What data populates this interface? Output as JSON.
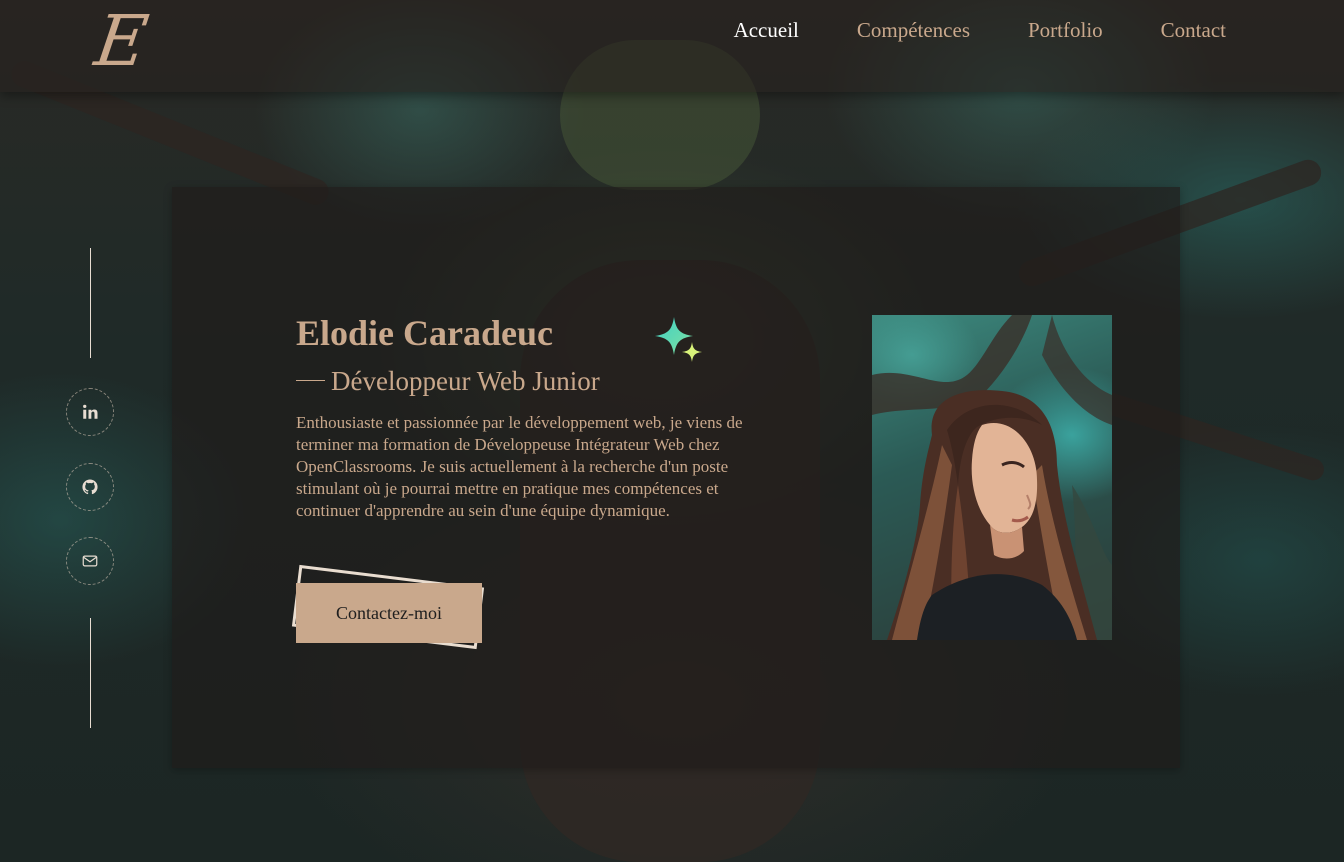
{
  "header": {
    "logo_letter": "E",
    "nav": [
      {
        "label": "Accueil",
        "active": true
      },
      {
        "label": "Compétences",
        "active": false
      },
      {
        "label": "Portfolio",
        "active": false
      },
      {
        "label": "Contact",
        "active": false
      }
    ]
  },
  "social": [
    {
      "name": "linkedin-icon"
    },
    {
      "name": "github-icon"
    },
    {
      "name": "mail-icon"
    }
  ],
  "hero": {
    "name": "Elodie Caradeuc",
    "subtitle": "Développeur Web Junior",
    "bio": "Enthousiaste et passionnée par le développement web, je viens de terminer ma formation de Développeuse Intégrateur Web chez OpenClassrooms. Je suis actuellement à la recherche d'un poste stimulant où je pourrai mettre en pratique mes compétences et continuer d'apprendre au sein d'une équipe dynamique.",
    "cta_label": "Contactez-moi"
  },
  "colors": {
    "accent": "#c9a88c",
    "nav_active": "#ffffff",
    "button_text": "#1e1e1e"
  }
}
